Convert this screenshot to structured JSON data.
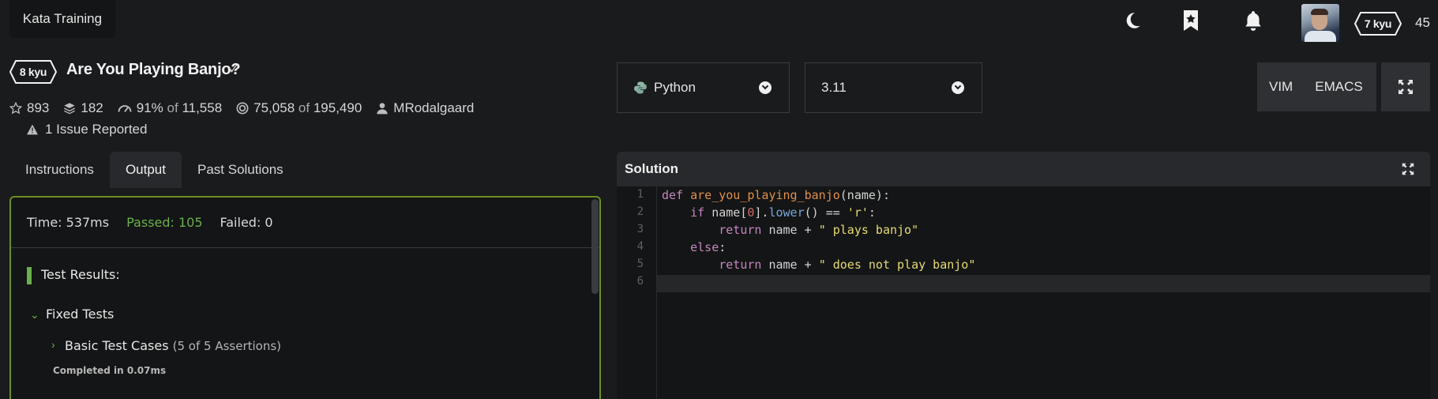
{
  "topbar": {
    "logo_label": "Kata Training",
    "user_rank": "7 kyu",
    "honor": "45",
    "icons": [
      "moon-icon",
      "bookmark-star-icon",
      "bell-icon"
    ]
  },
  "kata": {
    "rank": "8 kyu",
    "title": "Are You Playing Banjo?",
    "check_mark": "✓",
    "stats": {
      "stars": "893",
      "collections": "182",
      "satisfaction": "91%",
      "satisfaction_of": "of",
      "votes": "11,558",
      "completed": "75,058",
      "completed_of": "of",
      "attempts": "195,490",
      "author": "MRodalgaard"
    },
    "issues": "1 Issue Reported"
  },
  "tabs": [
    {
      "label": "Instructions",
      "active": false
    },
    {
      "label": "Output",
      "active": true
    },
    {
      "label": "Past Solutions",
      "active": false
    }
  ],
  "output": {
    "time": "Time: 537ms",
    "passed": "Passed: 105",
    "failed": "Failed: 0",
    "results_title": "Test Results:",
    "group_title": "Fixed Tests",
    "subgroup_title": "Basic Test Cases",
    "subgroup_assertions": "(5 of 5 Assertions)",
    "completed": "Completed in 0.07ms"
  },
  "language_select": {
    "value": "Python"
  },
  "version_select": {
    "value": "3.11"
  },
  "keybindings": {
    "vim": "VIM",
    "emacs": "EMACS"
  },
  "editor": {
    "title": "Solution",
    "line_numbers": [
      "1",
      "2",
      "3",
      "4",
      "5",
      "6"
    ],
    "code": [
      "def are_you_playing_banjo(name):",
      "    if name[0].lower() == 'r':",
      "        return name + \" plays banjo\"",
      "    else:",
      "        return name + \" does not play banjo\"",
      ""
    ]
  },
  "colors": {
    "accent_green": "#6ab04c",
    "panel_border": "#6b8e23",
    "background": "#1a1b1d"
  }
}
